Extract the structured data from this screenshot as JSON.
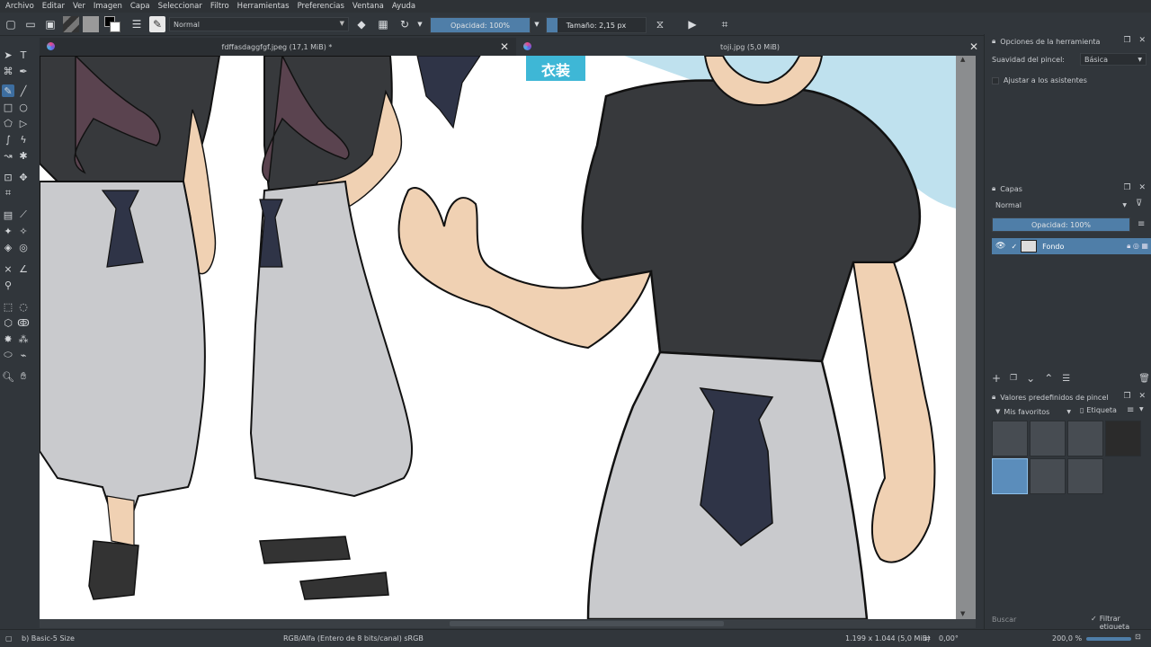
{
  "menu": [
    "Archivo",
    "Editar",
    "Ver",
    "Imagen",
    "Capa",
    "Seleccionar",
    "Filtro",
    "Herramientas",
    "Preferencias",
    "Ventana",
    "Ayuda"
  ],
  "toolbar": {
    "blend_mode": "Normal",
    "opacity_label": "Opacidad: 100%",
    "size_label": "Tamaño: 2,15 px"
  },
  "tabs": [
    {
      "title": "fdffasdaggfgf.jpeg (17,1 MiB) *"
    },
    {
      "title": "toji.jpg (5,0 MiB)"
    }
  ],
  "canvas": {
    "overlay_text": "衣装"
  },
  "tool_options": {
    "title": "Opciones de la herramienta",
    "smoothing_label": "Suavidad del pincel:",
    "smoothing_value": "Básica",
    "assistant_label": "Ajustar a los asistentes"
  },
  "layers": {
    "title": "Capas",
    "blend_mode": "Normal",
    "opacity_label": "Opacidad: 100%",
    "items": [
      {
        "name": "Fondo"
      }
    ]
  },
  "brush_presets": {
    "title": "Valores predefinidos de pincel",
    "tag": "Mis favoritos",
    "tag_button": "Etiqueta",
    "search_placeholder": "Buscar",
    "filter_label": "Filtrar etiqueta"
  },
  "status": {
    "brush": "b) Basic-5 Size",
    "color_space": "RGB/Alfa (Entero de 8 bits/canal)  sRGB",
    "dimensions": "1.199 x 1.044 (5,0 MiB)",
    "rotation": "0,00°",
    "zoom": "200,0 %"
  },
  "colors": {
    "accent": "#4f7ea8",
    "bg": "#31363b"
  }
}
